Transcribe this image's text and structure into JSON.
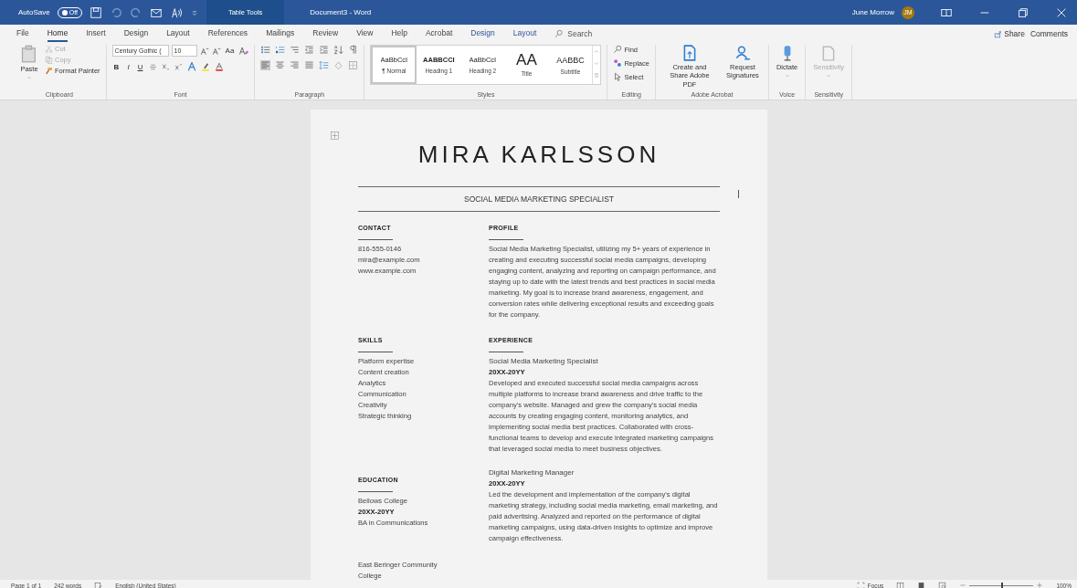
{
  "title_bar": {
    "autosave_label": "AutoSave",
    "autosave_state": "Off",
    "autosave_on": false,
    "context_tab": "Table Tools",
    "document_title": "Document3  -  Word",
    "user_name": "June Morrow",
    "user_initials": "JM"
  },
  "ribbon_tabs": [
    {
      "label": "File",
      "kind": "normal",
      "selected": false
    },
    {
      "label": "Home",
      "kind": "normal",
      "selected": true
    },
    {
      "label": "Insert",
      "kind": "normal",
      "selected": false
    },
    {
      "label": "Design",
      "kind": "normal",
      "selected": false
    },
    {
      "label": "Layout",
      "kind": "normal",
      "selected": false
    },
    {
      "label": "References",
      "kind": "normal",
      "selected": false
    },
    {
      "label": "Mailings",
      "kind": "normal",
      "selected": false
    },
    {
      "label": "Review",
      "kind": "normal",
      "selected": false
    },
    {
      "label": "View",
      "kind": "normal",
      "selected": false
    },
    {
      "label": "Help",
      "kind": "normal",
      "selected": false
    },
    {
      "label": "Acrobat",
      "kind": "normal",
      "selected": false
    },
    {
      "label": "Design",
      "kind": "contextual",
      "selected": false
    },
    {
      "label": "Layout",
      "kind": "contextual",
      "selected": false
    }
  ],
  "search": {
    "placeholder": "Search"
  },
  "share_button": "Share",
  "comments_button": "Comments",
  "clipboard": {
    "label": "Clipboard",
    "paste": "Paste",
    "cut": "Cut",
    "copy": "Copy",
    "format_painter": "Format Painter"
  },
  "font": {
    "label": "Font",
    "font_name": "Century Gothic (",
    "font_size": "10",
    "case_button": "Aa",
    "bold": "B",
    "italic": "I",
    "underline": "U"
  },
  "paragraph": {
    "label": "Paragraph"
  },
  "styles": {
    "label": "Styles",
    "items": [
      {
        "preview": "AaBbCcI",
        "name": "¶ Normal",
        "kind": "normal",
        "selected": true
      },
      {
        "preview": "AABBCCI",
        "name": "Heading 1",
        "kind": "bold",
        "selected": false
      },
      {
        "preview": "AaBbCcI",
        "name": "Heading 2",
        "kind": "normal",
        "selected": false
      },
      {
        "preview": "AA",
        "name": "Title",
        "kind": "large",
        "selected": false
      },
      {
        "preview": "AABBC",
        "name": "Subtitle",
        "kind": "caps",
        "selected": false
      }
    ]
  },
  "editing": {
    "label": "Editing",
    "find": "Find",
    "replace": "Replace",
    "select": "Select"
  },
  "acrobat": {
    "label": "Adobe Acrobat",
    "create": "Create and Share Adobe PDF",
    "request": "Request Signatures"
  },
  "voice": {
    "label": "Voice",
    "dictate": "Dictate"
  },
  "sensitivity": {
    "label": "Sensitivity",
    "button": "Sensitivity",
    "disabled": true
  },
  "document": {
    "name": "MIRA KARLSSON",
    "subtitle": "SOCIAL MEDIA MARKETING SPECIALIST",
    "contact": {
      "heading": "CONTACT",
      "lines": [
        "816-555-0146",
        "mira@example.com",
        "www.example.com"
      ]
    },
    "profile": {
      "heading": "PROFILE",
      "text": "Social Media Marketing Specialist, utilizing my 5+ years of experience in creating and executing successful social media campaigns, developing engaging content, analyzing and reporting on campaign performance, and staying up to date with the latest trends and best practices in social media marketing. My goal is to increase brand awareness, engagement, and conversion rates while delivering exceptional results and exceeding goals for the company."
    },
    "skills": {
      "heading": "SKILLS",
      "items": [
        "Platform expertise",
        "Content creation",
        "Analytics",
        "Communication",
        "Creativity",
        "Strategic thinking"
      ]
    },
    "experience": {
      "heading": "EXPERIENCE",
      "entries": [
        {
          "title": "Social Media Marketing Specialist",
          "dates": "20XX-20YY",
          "text": "Developed and executed successful social media campaigns across multiple platforms to increase brand awareness and drive traffic to the company's website. Managed and grew the company's social media accounts by creating engaging content, monitoring analytics, and implementing social media best practices. Collaborated with cross-functional teams to develop and execute integrated marketing campaigns that leveraged social media to meet business objectives."
        },
        {
          "title": "Digital Marketing Manager",
          "dates": "20XX-20YY",
          "text": "Led the development and implementation of the company's digital marketing strategy, including social media marketing, email marketing, and paid advertising. Analyzed and reported on the performance of digital marketing campaigns, using data-driven insights to optimize and improve campaign effectiveness."
        }
      ]
    },
    "education": {
      "heading": "EDUCATION",
      "entries": [
        {
          "school": "Bellows College",
          "dates": "20XX-20YY",
          "degree": "BA in Communications"
        },
        {
          "school": "East Beringer Community College"
        }
      ]
    }
  },
  "status_bar": {
    "page": "Page 1 of 1",
    "words": "242 words",
    "language": "English (United States)",
    "focus": "Focus",
    "zoom": {
      "level": 0.5,
      "reading": "100%"
    }
  }
}
